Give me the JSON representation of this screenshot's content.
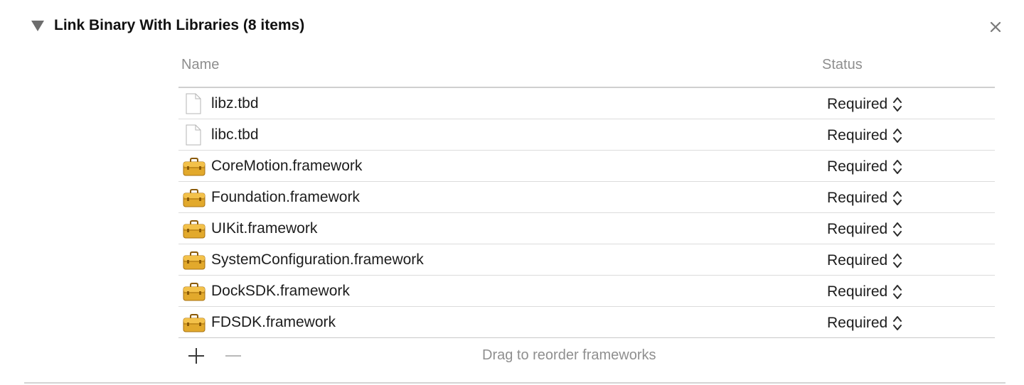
{
  "section": {
    "title": "Link Binary With Libraries (8 items)"
  },
  "columns": {
    "name": "Name",
    "status": "Status"
  },
  "libraries": [
    {
      "name": "libz.tbd",
      "type": "tbd",
      "status": "Required"
    },
    {
      "name": "libc.tbd",
      "type": "tbd",
      "status": "Required"
    },
    {
      "name": "CoreMotion.framework",
      "type": "framework",
      "status": "Required"
    },
    {
      "name": "Foundation.framework",
      "type": "framework",
      "status": "Required"
    },
    {
      "name": "UIKit.framework",
      "type": "framework",
      "status": "Required"
    },
    {
      "name": "SystemConfiguration.framework",
      "type": "framework",
      "status": "Required"
    },
    {
      "name": "DockSDK.framework",
      "type": "framework",
      "status": "Required"
    },
    {
      "name": "FDSDK.framework",
      "type": "framework",
      "status": "Required"
    }
  ],
  "footer": {
    "hint": "Drag to reorder frameworks"
  },
  "icons": {
    "disclosure": "disclosure-triangle-icon",
    "close": "close-icon",
    "file": "document-icon",
    "framework": "toolbox-icon",
    "stepper": "up-down-chevron-icon",
    "add": "plus-icon",
    "remove": "minus-icon"
  },
  "colors": {
    "framework_icon": "#e2a92c",
    "header_text": "#8e8e8e",
    "separator": "#dcdcdc"
  }
}
